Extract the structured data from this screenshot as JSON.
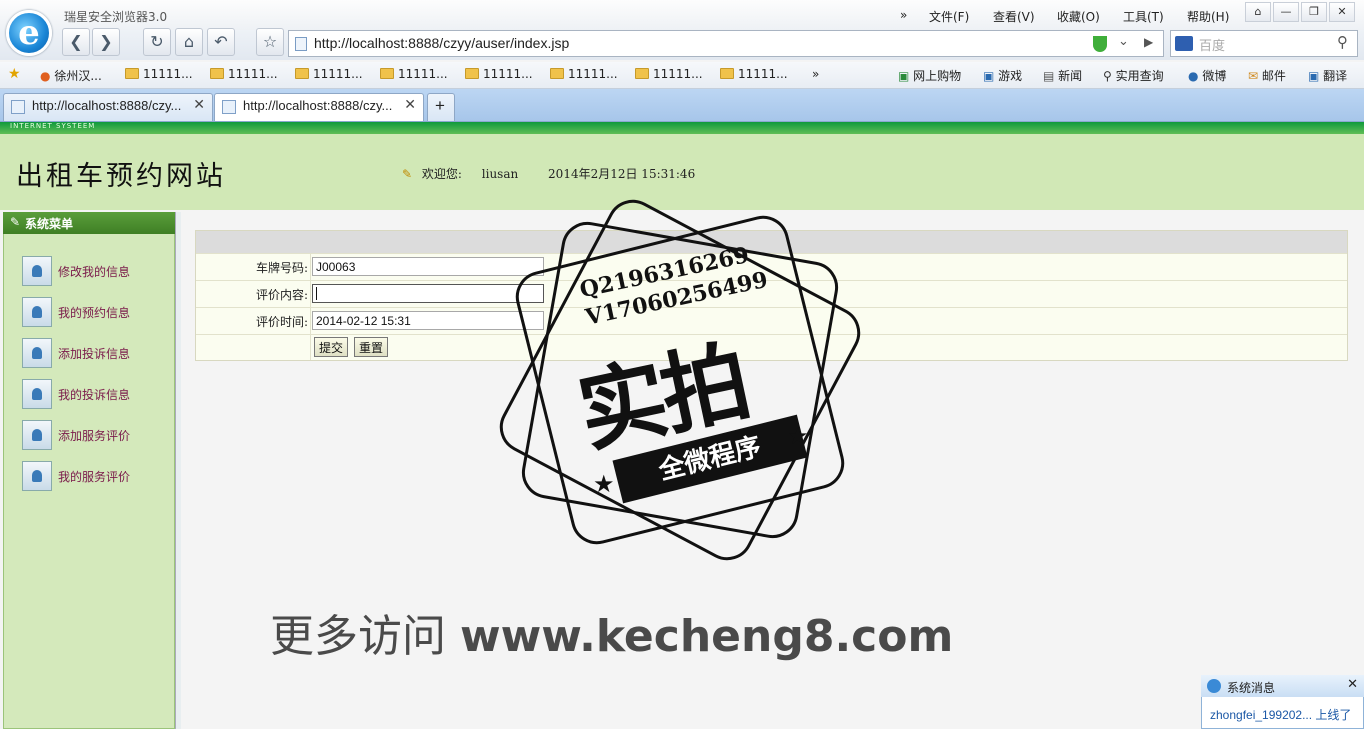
{
  "browser": {
    "app_title": "瑞星安全浏览器3.0",
    "menu": [
      "文件(F)",
      "查看(V)",
      "收藏(O)",
      "工具(T)",
      "帮助(H)"
    ],
    "menu_overflow": "»",
    "address": "http://localhost:8888/czyy/auser/index.jsp",
    "search_placeholder": "百度",
    "favorites": [
      "徐州汉...",
      "11111...",
      "11111...",
      "11111...",
      "11111...",
      "11111...",
      "11111...",
      "11111..."
    ],
    "favorites_overflow": "»",
    "quicklinks": [
      "网上购物",
      "游戏",
      "新闻",
      "实用查询",
      "微博",
      "邮件",
      "翻译"
    ],
    "tabs": [
      {
        "title": "http://localhost:8888/czy..."
      },
      {
        "title": "http://localhost:8888/czy..."
      }
    ],
    "new_tab": "+"
  },
  "page": {
    "strip_text": "INTERNET SYSTEEM",
    "site_title": "出租车预约网站",
    "welcome_label": "欢迎您:",
    "username": "liusan",
    "datetime": "2014年2月12日  15:31:46",
    "sidebar_title": "系统菜单",
    "sidebar_items": [
      "修改我的信息",
      "我的预约信息",
      "添加投诉信息",
      "我的投诉信息",
      "添加服务评价",
      "我的服务评价"
    ]
  },
  "form": {
    "plate_label": "车牌号码:",
    "plate_value": "J00063",
    "content_label": "评价内容:",
    "content_value": "",
    "time_label": "评价时间:",
    "time_value": "2014-02-12 15:31",
    "submit": "提交",
    "reset": "重置"
  },
  "watermark": {
    "qq": "Q2196316269",
    "v": "V17060256499",
    "big": "实拍",
    "band": "全微程序",
    "site_prefix": "更多访问",
    "site_url": "www.kecheng8.com"
  },
  "notification": {
    "title": "系统消息",
    "body": "zhongfei_199202... 上线了"
  }
}
